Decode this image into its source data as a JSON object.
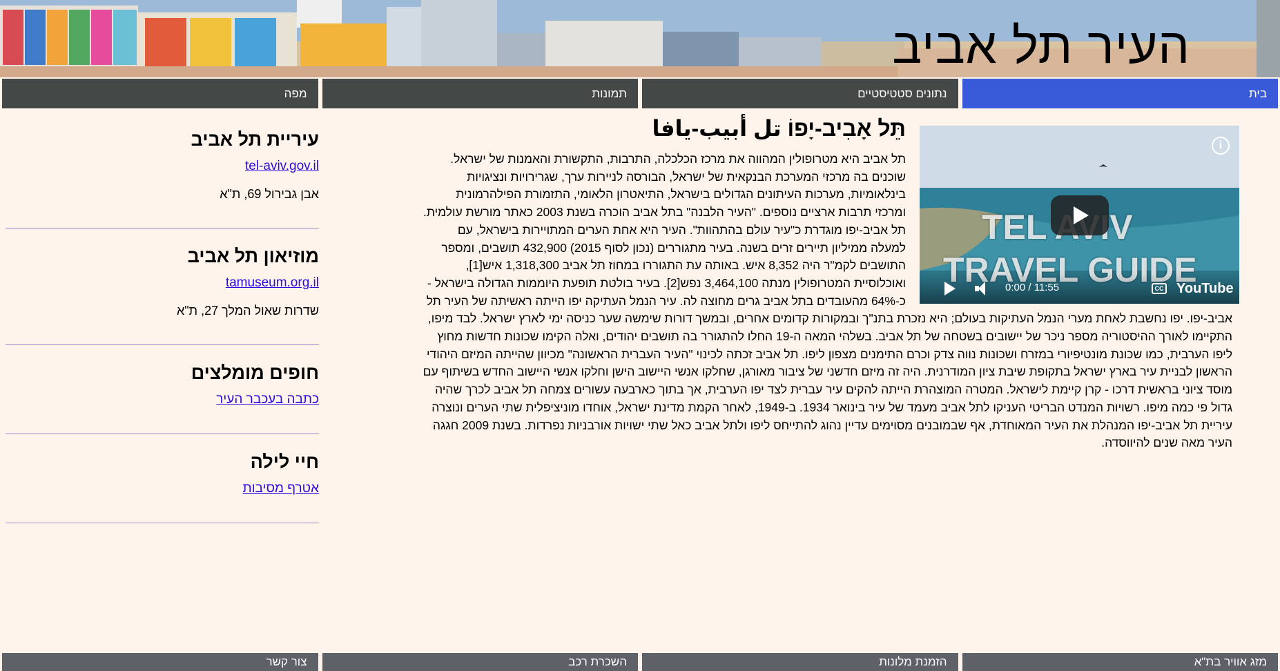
{
  "header": {
    "title": "העיר תל אביב"
  },
  "top_nav": [
    {
      "label": "בית",
      "active": true
    },
    {
      "label": "נתונים סטטיסטיים",
      "active": false
    },
    {
      "label": "תמונות",
      "active": false
    },
    {
      "label": "מפה",
      "active": false
    }
  ],
  "article": {
    "title": "תֵּל אָבִיב-יָפוֹ تل أبيب-يافا",
    "body": "תל אביב היא מטרופולין המהווה את מרכז הכלכלה, התרבות, התקשורת והאמנות של ישראל. שוכנים בה מרכזי המערכת הבנקאית של ישראל, הבורסה לניירות ערך, שגרירויות ונציגויות בינלאומיות, מערכות העיתונים הגדולים בישראל, התיאטרון הלאומי, התזמורת הפילהרמונית ומרכזי תרבות ארציים נוספים. \"העיר הלבנה\" בתל אביב הוכרה בשנת 2003 כאתר מורשת עולמית. תל אביב-יפו מוגדרת כ\"עיר עולם בהתהוות\". העיר היא אחת הערים המתויירות בישראל, עם למעלה ממיליון תיירים זרים בשנה. בעיר מתגוררים (נכון לסוף 2015) 432,900 תושבים, ומספר התושבים לקמ\"ר היה 8,352 איש. באותה עת התגוררו במחוז תל אביב 1,318,300 איש[1], ואוכלוסיית המטרופולין מנתה 3,464,100 נפש[2]. בעיר בולטת תופעת היוממות הגדולה בישראל - כ-64% מהעובדים בתל אביב גרים מחוצה לה. עיר הנמל העתיקה יפו הייתה ראשיתה של העיר תל אביב-יפו. יפו נחשבת לאחת מערי הנמל העתיקות בעולם; היא נזכרת בתנ\"ך ובמקורות קדומים אחרים, ובמשך דורות שימשה שער כניסה ימי לארץ ישראל. לבד מיפו, התקיימו לאורך ההיסטוריה מספר ניכר של יישובים בשטחה של תל אביב. בשלהי המאה ה-19 החלו להתגורר בה תושבים יהודים, ואלה הקימו שכונות חדשות מחוץ ליפו הערבית, כמו שכונת מונטיפיורי במזרח ושכונות נווה צדק וכרם התימנים מצפון ליפו. תל אביב זכתה לכינוי \"העיר העברית הראשונה\" מכיוון שהייתה המיזם היהודי הראשון לבניית עיר בארץ ישראל בתקופת שיבת ציון המודרנית. היה זה מיזם חדשני של ציבור מאורגן, שחלקו אנשי היישוב הישן וחלקו אנשי היישוב החדש בשיתוף עם מוסד ציוני בראשית דרכו - קרן קיימת לישראל. המטרה המוצהרת הייתה להקים עיר עברית לצד יפו הערבית, אך בתוך כארבעה עשורים צמחה תל אביב לכרך שהיה גדול פי כמה מיפו. רשויות המנדט הבריטי העניקו לתל אביב מעמד של עיר בינואר 1934. ב-1949, לאחר הקמת מדינת ישראל, אוחדו מוניציפלית שתי הערים ונוצרה עיריית תל אביב-יפו המנהלת את העיר המאוחדת, אף שבמובנים מסוימים עדיין נהוג להתייחס ליפו ולתל אביב כאל שתי ישויות אורבניות נפרדות. בשנת 2009 חגגה העיר מאה שנים להיווסדה."
  },
  "video": {
    "title_line1": "TEL AVIV",
    "title_line2": "TRAVEL GUIDE",
    "time": "0:00 / 11:55",
    "brand": "YouTube"
  },
  "sidebar": [
    {
      "title": "עיריית תל אביב",
      "link": "tel-aviv.gov.il",
      "address": "אבן גבירול 69, ת\"א"
    },
    {
      "title": "מוזיאון תל אביב",
      "link": "tamuseum.org.il",
      "address": "שדרות שאול המלך 27, ת\"א"
    },
    {
      "title": "חופים מומלצים",
      "link": "כתבה בעכבר העיר",
      "address": ""
    },
    {
      "title": "חיי לילה",
      "link": "אטרף מסיבות",
      "address": ""
    }
  ],
  "bottom_nav": [
    {
      "label": "מזג אוויר בת\"א"
    },
    {
      "label": "הזמנת מלונות"
    },
    {
      "label": "השכרת רכב"
    },
    {
      "label": "צור קשר"
    }
  ],
  "colors": {
    "background": "#fff4ec",
    "nav": "#444846",
    "nav_active": "#3a5bd9",
    "link": "#2a0de0"
  }
}
